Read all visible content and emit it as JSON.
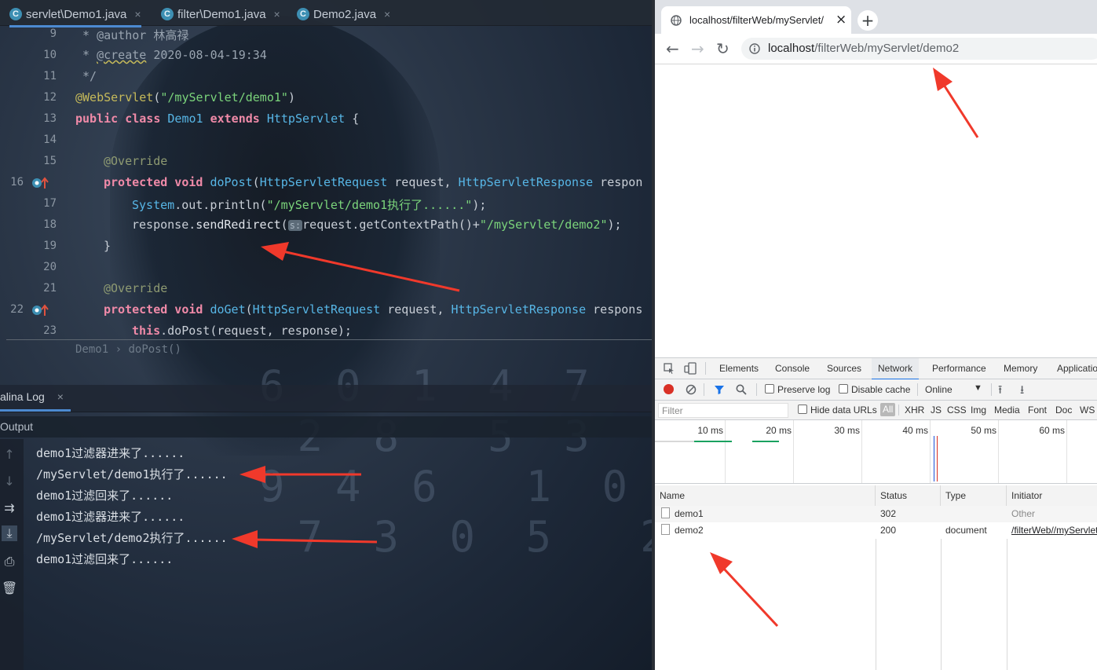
{
  "ide": {
    "tabs": [
      {
        "label": "servlet\\Demo1.java",
        "close": "×",
        "icon": "C"
      },
      {
        "label": "filter\\Demo1.java",
        "close": "×",
        "icon": "C"
      },
      {
        "label": "Demo2.java",
        "close": "×",
        "icon": "C"
      }
    ],
    "line_numbers": [
      "9",
      "10",
      "11",
      "12",
      "13",
      "14",
      "15",
      "16",
      "17",
      "18",
      "19",
      "20",
      "21",
      "22",
      "23"
    ],
    "code": {
      "l9": {
        "prefix": " * @author ",
        "value": "林高禄"
      },
      "l10": {
        "prefix": " * ",
        "tag": "@create",
        "value": " 2020-08-04-19:34"
      },
      "l11": " */",
      "l12": {
        "annotation": "@WebServlet",
        "open": "(",
        "path": "\"/myServlet/demo1\"",
        "close": ")"
      },
      "l13": {
        "kw1": "public class ",
        "cls": "Demo1",
        "kw2": " extends ",
        "parent": "HttpServlet",
        "rest": " {"
      },
      "l15": "@Override",
      "l16": {
        "kw": "protected void ",
        "method": "doPost",
        "p1": "(",
        "t1": "HttpServletRequest",
        "a1": " request, ",
        "t2": "HttpServletResponse",
        "a2": " respon"
      },
      "l17": {
        "cls": "System",
        "rest": ".out.println(",
        "str": "\"/myServlet/demo1执行了......\"",
        "end": ");"
      },
      "l18": {
        "obj": "response.",
        "call": "sendRedirect",
        "open": "(",
        "hint": "s:",
        "mid": "request.getContextPath()+",
        "str": "\"/myServlet/demo2\"",
        "end": ");"
      },
      "l19": "}",
      "l21": "@Override",
      "l22": {
        "kw": "protected void ",
        "method": "doGet",
        "p1": "(",
        "t1": "HttpServletRequest",
        "a1": " request, ",
        "t2": "HttpServletResponse",
        "a2": " respons"
      },
      "l23": {
        "kw": "this",
        "rest": ".doPost(request, response);"
      }
    },
    "breadcrumb": {
      "cls": "Demo1",
      "sep": "›",
      "method": "doPost()"
    },
    "bottom_tab": {
      "label": "alina Log",
      "close": "×"
    },
    "output_label": "Output",
    "log_lines": [
      "demo1过滤器进来了......",
      "/myServlet/demo1执行了......",
      "demo1过滤回来了......",
      "demo1过滤器进来了......",
      "/myServlet/demo2执行了......",
      "demo1过滤回来了......"
    ]
  },
  "browser": {
    "tab_title": "localhost/filterWeb/myServlet/",
    "tab_close": "×",
    "new_tab": "+",
    "url": {
      "host": "localhost",
      "path": "/filterWeb/myServlet/demo2"
    },
    "devtools": {
      "tabs": [
        "Elements",
        "Console",
        "Sources",
        "Network",
        "Performance",
        "Memory",
        "Applicatio"
      ],
      "selected_tab": "Network",
      "preserve_log": "Preserve log",
      "disable_cache": "Disable cache",
      "throttle": "Online",
      "filter_placeholder": "Filter",
      "hide_data_urls": "Hide data URLs",
      "type_filters": [
        "All",
        "XHR",
        "JS",
        "CSS",
        "Img",
        "Media",
        "Font",
        "Doc",
        "WS"
      ],
      "timeline_ticks": [
        "10 ms",
        "20 ms",
        "30 ms",
        "40 ms",
        "50 ms",
        "60 ms"
      ],
      "columns": [
        "Name",
        "Status",
        "Type",
        "Initiator"
      ],
      "rows": [
        {
          "name": "demo1",
          "status": "302",
          "type": "",
          "initiator": "Other"
        },
        {
          "name": "demo2",
          "status": "200",
          "type": "document",
          "initiator": "/filterWeb//myServlet/"
        }
      ]
    }
  },
  "colors": {
    "keyword": "#f08aa8",
    "class": "#57b6e6",
    "string": "#7bd47b",
    "annotation_arrow": "#f0392b",
    "network_tab_underline": "#1a73e8"
  }
}
